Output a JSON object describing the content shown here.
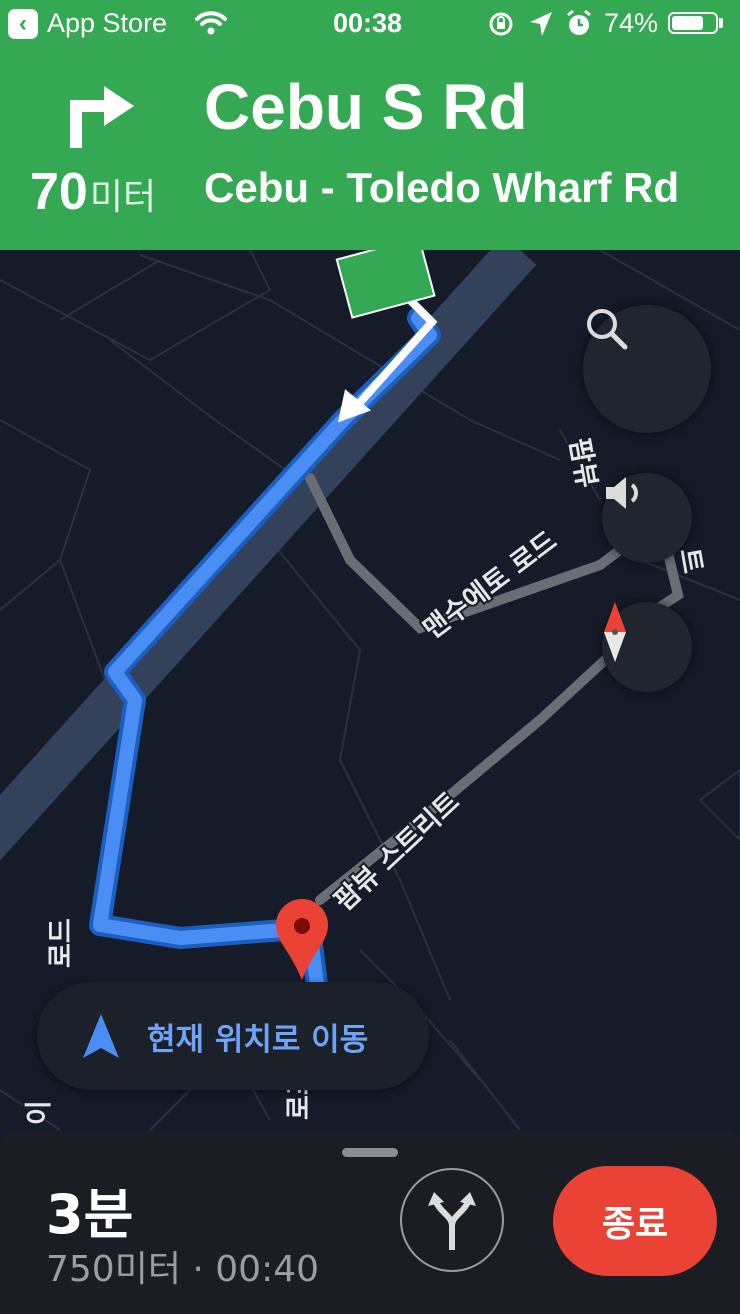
{
  "status_bar": {
    "back_app": "App Store",
    "time": "00:38",
    "battery": "74%",
    "battery_level": 0.74
  },
  "instruction": {
    "distance_value": "70",
    "distance_unit": "미터",
    "maneuver_icon": "turn-right-icon",
    "street_primary": "Cebu S Rd",
    "street_secondary": "Cebu - Toledo Wharf Rd"
  },
  "map": {
    "labels": {
      "road_a_part": "팜뷰",
      "road_b": "맨수에토 로드",
      "road_b_end": "트",
      "road_c": "팜뷰 스트리트",
      "road_d": "로드",
      "road_e": "이",
      "road_f": "로즈"
    },
    "buttons": {
      "search_icon": "search-icon",
      "sound_icon": "volume-icon",
      "compass_icon": "compass-icon"
    },
    "route_color": "#4a8ef5",
    "destination_color": "#ea4335"
  },
  "recenter": {
    "label": "현재 위치로 이동"
  },
  "trip": {
    "eta_duration": "3분",
    "eta_details": "750미터 · 00:40",
    "end_label": "종료",
    "alt_routes_icon": "alternate-routes-icon"
  }
}
